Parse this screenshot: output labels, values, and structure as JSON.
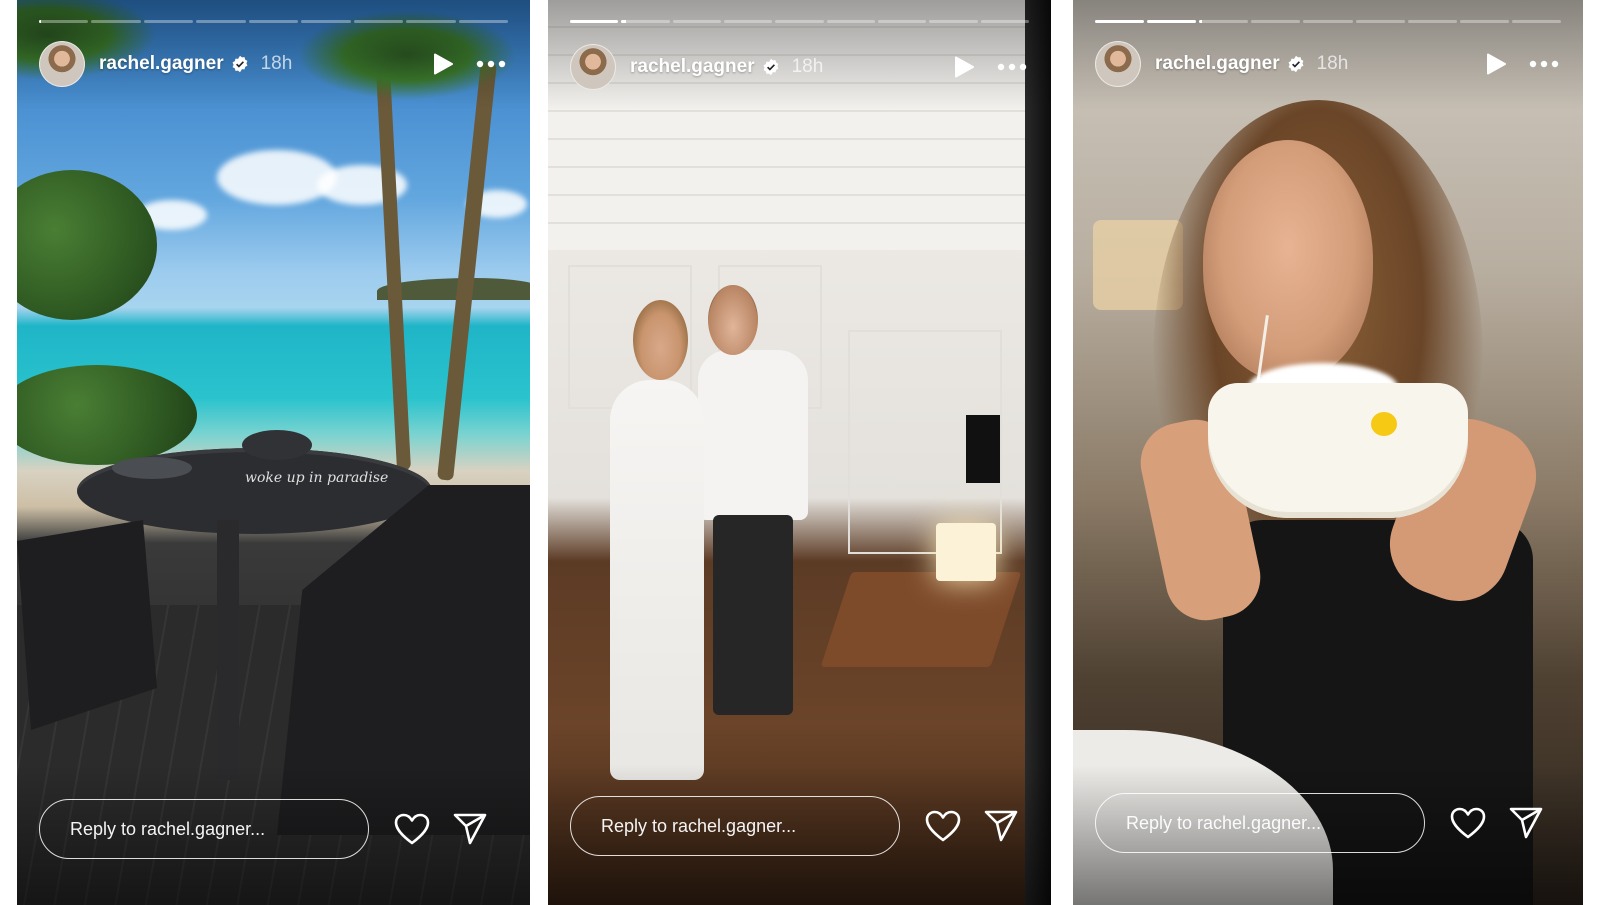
{
  "stories": [
    {
      "username": "rachel.gagner",
      "time": "18h",
      "reply_placeholder": "Reply to rachel.gagner...",
      "caption": "woke up in paradise",
      "progress": {
        "segments": 9,
        "active_index": 0,
        "active_fill": 0.05
      }
    },
    {
      "username": "rachel.gagner",
      "time": "18h",
      "reply_placeholder": "Reply to rachel.gagner...",
      "progress": {
        "segments": 9,
        "active_index": 1,
        "active_fill": 0.1
      }
    },
    {
      "username": "rachel.gagner",
      "time": "18h",
      "reply_placeholder": "Reply to rachel.gagner...",
      "progress": {
        "segments": 9,
        "active_index": 2,
        "active_fill": 0.05
      }
    }
  ],
  "icons": {
    "verified": "verified-badge-icon",
    "play": "play-icon",
    "more": "more-options-icon",
    "like": "heart-icon",
    "share": "send-icon"
  },
  "colors": {
    "overlay_text": "#ffffff",
    "progress_track": "rgba(255,255,255,0.35)",
    "progress_fill": "#ffffff"
  }
}
